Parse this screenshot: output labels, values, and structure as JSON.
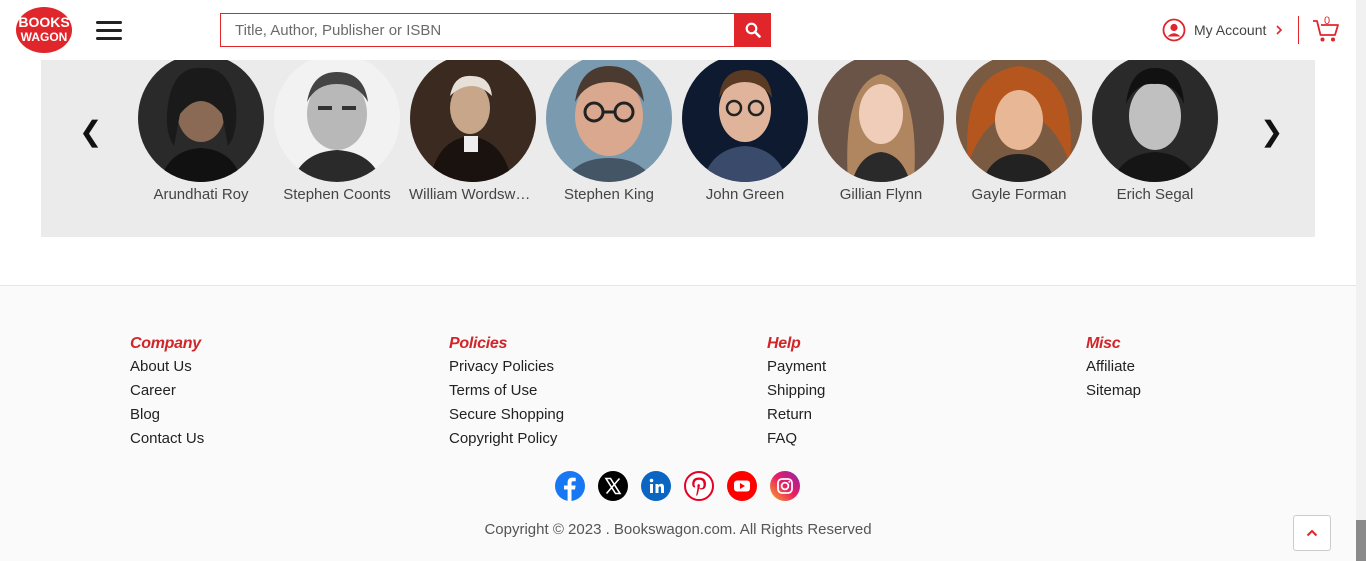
{
  "header": {
    "logo_line1": "BOOKS",
    "logo_line2": "WAGON",
    "search_placeholder": "Title, Author, Publisher or ISBN",
    "account_label": "My Account",
    "cart_count": "0",
    "brand_color": "#e0252b"
  },
  "authors": [
    {
      "name": "Arundhati Roy"
    },
    {
      "name": "Stephen Coonts"
    },
    {
      "name": "William Wordsworth"
    },
    {
      "name": "Stephen King"
    },
    {
      "name": "John Green"
    },
    {
      "name": "Gillian Flynn"
    },
    {
      "name": "Gayle Forman"
    },
    {
      "name": "Erich Segal"
    }
  ],
  "carousel": {
    "prev": "❮",
    "next": "❯"
  },
  "footer": {
    "columns": [
      {
        "title": "Company",
        "links": [
          "About Us",
          "Career",
          "Blog",
          "Contact Us"
        ]
      },
      {
        "title": "Policies",
        "links": [
          "Privacy Policies",
          "Terms of Use",
          "Secure Shopping",
          "Copyright Policy"
        ]
      },
      {
        "title": "Help",
        "links": [
          "Payment",
          "Shipping",
          "Return",
          "FAQ"
        ]
      },
      {
        "title": "Misc",
        "links": [
          "Affiliate",
          "Sitemap"
        ]
      }
    ],
    "socials": [
      "facebook-icon",
      "x-twitter-icon",
      "linkedin-icon",
      "pinterest-icon",
      "youtube-icon",
      "instagram-icon"
    ],
    "copyright": "Copyright © 2023 . Bookswagon.com. All Rights Reserved"
  }
}
